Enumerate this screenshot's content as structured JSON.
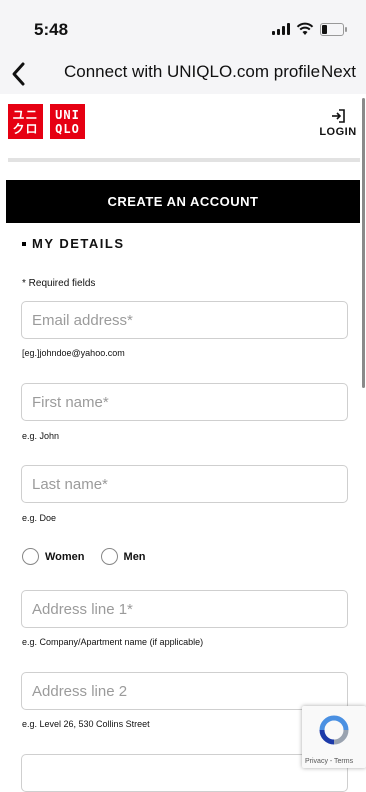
{
  "status_bar": {
    "time": "5:48"
  },
  "nav": {
    "title": "Connect with UNIQLO.com profile",
    "next_label": "Next"
  },
  "logo": {
    "left_text_top": "ユニ",
    "left_text_bottom": "クロ",
    "right_text_top": "UNI",
    "right_text_bottom": "QLO"
  },
  "header": {
    "login_label": "LOGIN"
  },
  "form": {
    "create_account_label": "CREATE AN ACCOUNT",
    "section_title": "MY DETAILS",
    "required_note": "* Required fields",
    "email": {
      "placeholder": "Email address*",
      "hint": "[eg.]johndoe@yahoo.com"
    },
    "first_name": {
      "placeholder": "First name*",
      "hint": "e.g. John"
    },
    "last_name": {
      "placeholder": "Last name*",
      "hint": "e.g. Doe"
    },
    "gender": {
      "option_women": "Women",
      "option_men": "Men"
    },
    "address1": {
      "placeholder": "Address line 1*",
      "hint": "e.g. Company/Apartment name (if applicable)"
    },
    "address2": {
      "placeholder": "Address line 2",
      "hint": "e.g. Level 26, 530 Collins Street"
    }
  },
  "recaptcha": {
    "label": "Privacy - Terms"
  },
  "colors": {
    "brand_red": "#e60012",
    "bar_black": "#000000"
  }
}
